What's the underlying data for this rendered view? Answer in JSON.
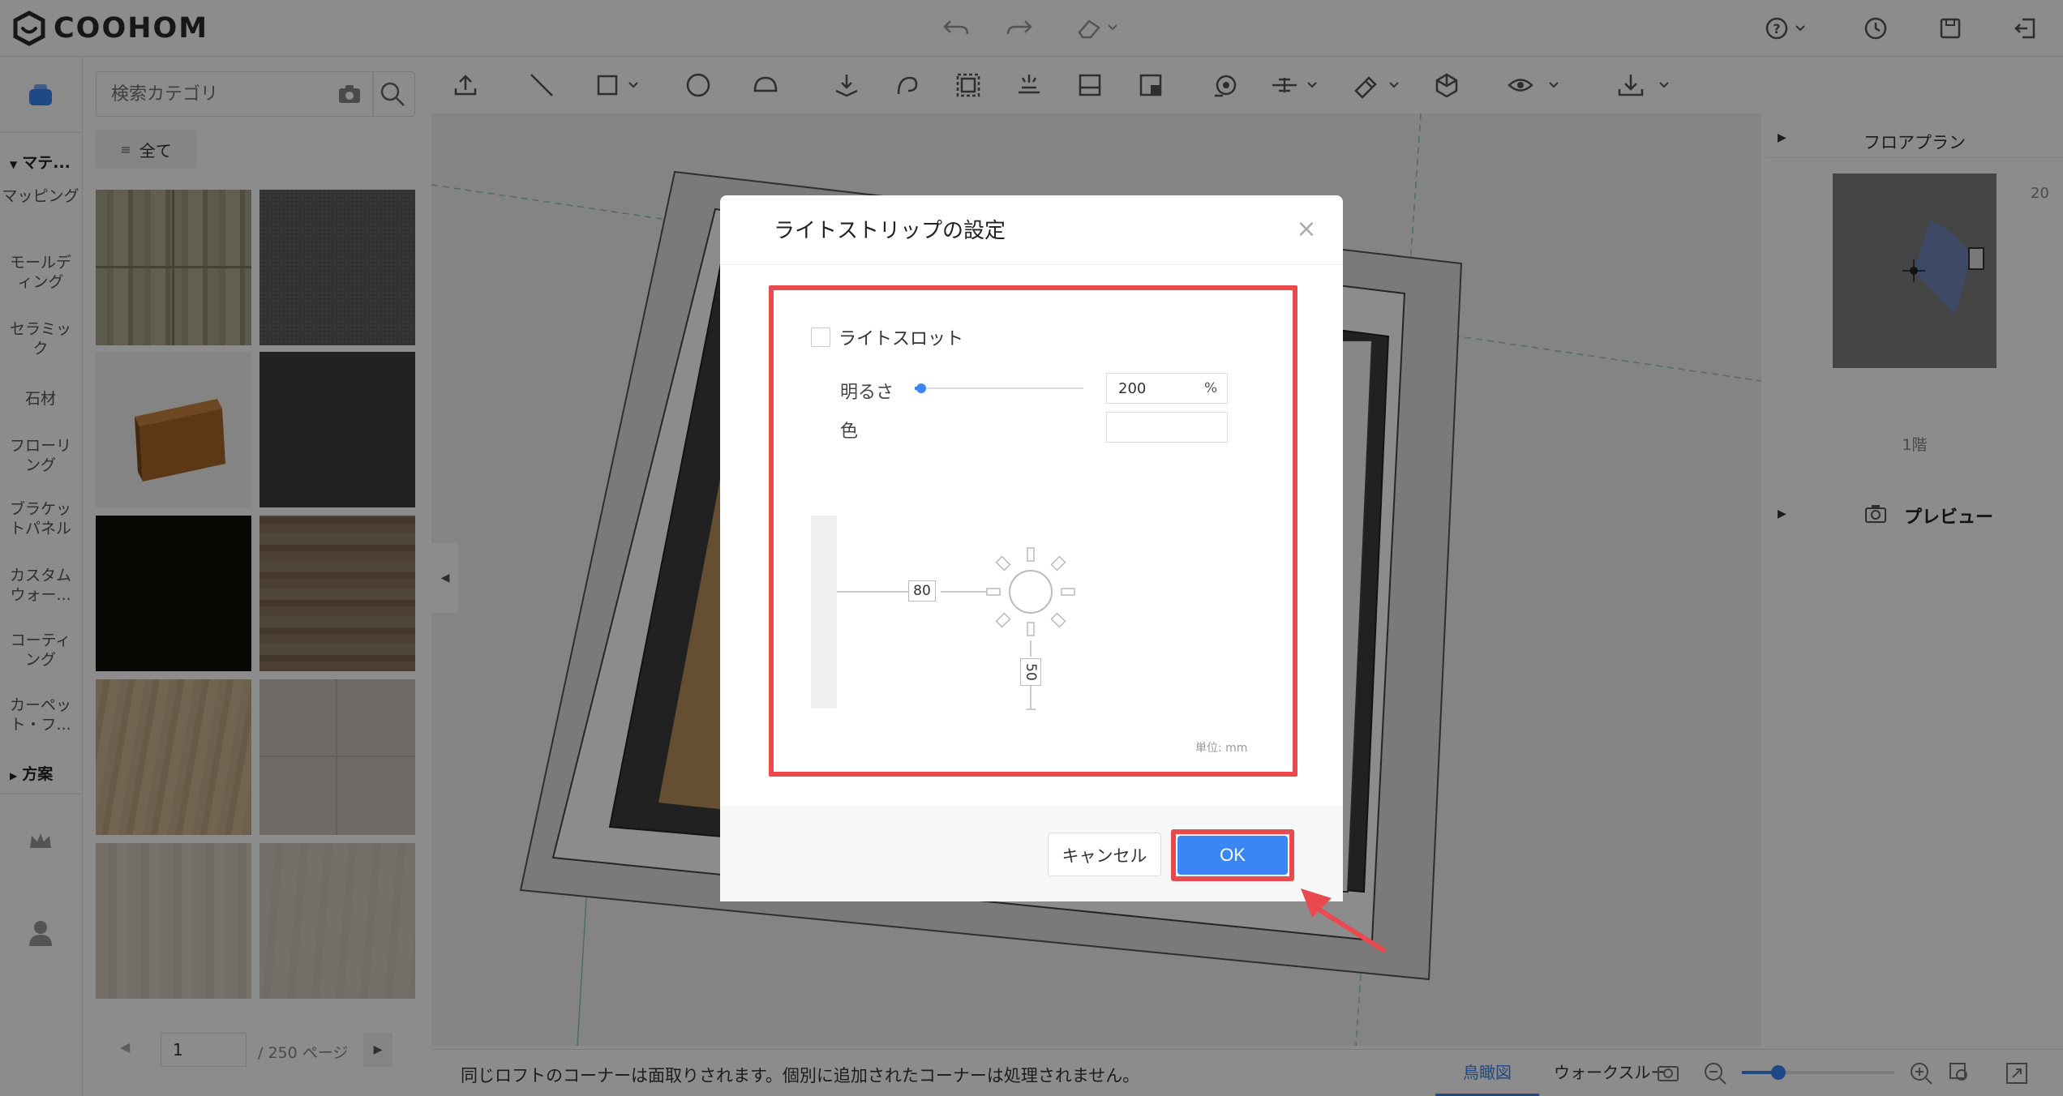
{
  "app": {
    "brand": "COOHOM"
  },
  "sidebar": {
    "categories_header": "マテ...",
    "items": [
      "マッピング",
      "モールディング",
      "セラミック",
      "石材",
      "フローリング",
      "ブラケットパネル",
      "カスタムウォー...",
      "コーティング",
      "カーペット・フ..."
    ],
    "plans_header": "方案"
  },
  "materials": {
    "search_placeholder": "検索カテゴリ",
    "filter_all": "全て",
    "page_current": "1",
    "page_total": "/ 250 ページ"
  },
  "right_panel": {
    "floorplan_title": "フロアプラン",
    "floorplan_scale": "20",
    "floor_label": "1階",
    "preview_title": "プレビュー"
  },
  "status": {
    "message": "同じロフトのコーナーは面取りされます。個別に追加されたコーナーは処理されません。",
    "view_tab_active": "鳥瞰図",
    "view_tab_other": "ウォークスルー"
  },
  "dialog": {
    "title": "ライトストリップの設定",
    "light_slot_label": "ライトスロット",
    "brightness_label": "明るさ",
    "brightness_value": "200",
    "brightness_unit": "%",
    "brightness_fraction": 0.02,
    "color_label": "色",
    "dim_horizontal": "80",
    "dim_vertical": "50",
    "unit_note": "単位: mm",
    "cancel_label": "キャンセル",
    "ok_label": "OK"
  },
  "colors": {
    "accent": "#3a86f5",
    "highlight": "#e84a4f",
    "logo": "#2b2b2b"
  }
}
